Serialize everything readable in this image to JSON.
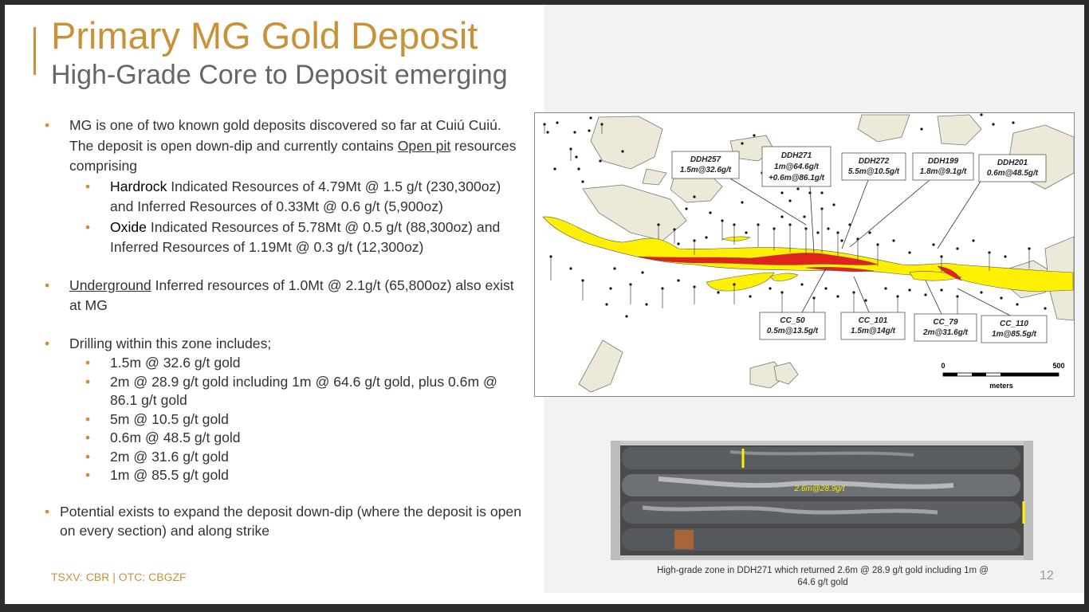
{
  "header": {
    "title": "Primary MG Gold Deposit",
    "subtitle": "High-Grade Core to Deposit emerging"
  },
  "content": {
    "p1_a": "MG is one of two known gold deposits discovered so far at Cuiú Cuiú. The deposit is open down-dip and currently contains ",
    "p1_link": "Open pit",
    "p1_b": " resources comprising",
    "hardrock_label": "Hardrock",
    "hardrock_text": " Indicated Resources of 4.79Mt @ 1.5 g/t (230,300oz) and Inferred Resources of 0.33Mt @ 0.6 g/t (5,900oz)",
    "oxide_label": "Oxide",
    "oxide_text": " Indicated Resources of 5.78Mt @ 0.5 g/t (88,300oz) and Inferred Resources of 1.19Mt @ 0.3 g/t (12,300oz)",
    "p2_link": "Underground",
    "p2_text": " Inferred resources of 1.0Mt @ 2.1g/t (65,800oz) also exist at MG",
    "p3_text": "Drilling within this zone includes;",
    "drill_results": [
      "1.5m @ 32.6 g/t gold",
      "2m @ 28.9 g/t gold including 1m @ 64.6 g/t gold, plus 0.6m @ 86.1 g/t gold",
      "5m @ 10.5 g/t gold",
      "0.6m @ 48.5 g/t gold",
      "2m @ 31.6 g/t gold",
      "1m @ 85.5 g/t gold"
    ],
    "p4_text": "Potential exists to expand the deposit down-dip (where the deposit is open on every section) and along strike"
  },
  "map": {
    "callouts_top": [
      {
        "hole": "DDH257",
        "result": "1.5m@32.6g/t"
      },
      {
        "hole": "DDH271",
        "result": "1m@64.6g/t",
        "result2": "+0.6m@86.1g/t"
      },
      {
        "hole": "DDH272",
        "result": "5.5m@10.5g/t"
      },
      {
        "hole": "DDH199",
        "result": "1.8m@9.1g/t"
      },
      {
        "hole": "DDH201",
        "result": "0.6m@48.5g/t"
      }
    ],
    "callouts_bottom": [
      {
        "hole": "CC_50",
        "result": "0.5m@13.5g/t"
      },
      {
        "hole": "CC_101",
        "result": "1.5m@14g/t"
      },
      {
        "hole": "CC_79",
        "result": "2m@31.6g/t"
      },
      {
        "hole": "CC_110",
        "result": "1m@85.5g/t"
      }
    ],
    "scale_min": "0",
    "scale_max": "500",
    "scale_unit": "meters",
    "colors": {
      "halo": "#ffef00",
      "core": "#e0241b",
      "outcrop": "#ece9d8"
    }
  },
  "core_photo": {
    "label": "2.6m@28.9g/t",
    "caption": "High-grade zone in DDH271 which returned 2.6m @ 28.9 g/t gold including 1m @ 64.6 g/t gold"
  },
  "footer": {
    "ticker": "TSXV: CBR | OTC: CBGZF",
    "page_number": "12"
  }
}
